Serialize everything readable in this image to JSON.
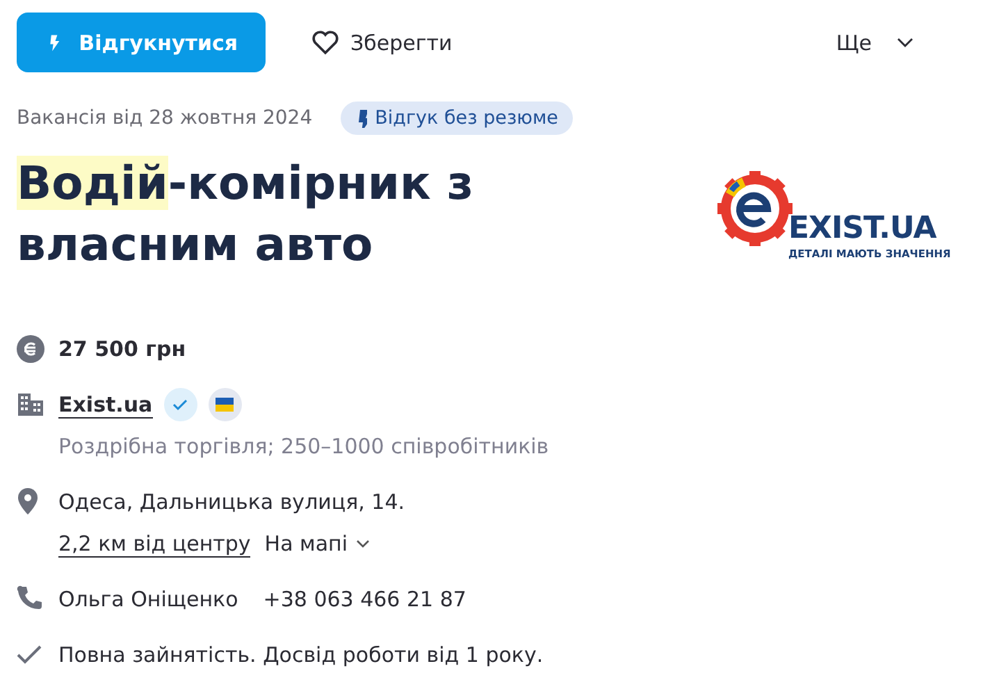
{
  "actions": {
    "apply": "Відгукнутися",
    "save": "Зберегти",
    "more": "Ще"
  },
  "posted": "Вакансія від 28 жовтня 2024",
  "badge": "Відгук без резюме",
  "title": {
    "highlight": "Водій",
    "rest": "-комірник з власним авто"
  },
  "logo": {
    "name": "EXIST.UA",
    "slogan": "ДЕТАЛІ МАЮТЬ ЗНАЧЕННЯ"
  },
  "salary": "27 500 грн",
  "company": {
    "name": "Exist.ua",
    "verified": true,
    "ukrainian": true,
    "details": "Роздрібна торгівля; 250–1000 співробітників"
  },
  "address": {
    "street": "Одеса, Дальницька вулиця, 14.",
    "distance": "2,2 км від центру",
    "map": "На мапі"
  },
  "contact": {
    "name": "Ольга Оніщенко",
    "phone": "+38 063 466 21 87"
  },
  "conditions": "Повна зайнятість. Досвід роботи від 1 року."
}
